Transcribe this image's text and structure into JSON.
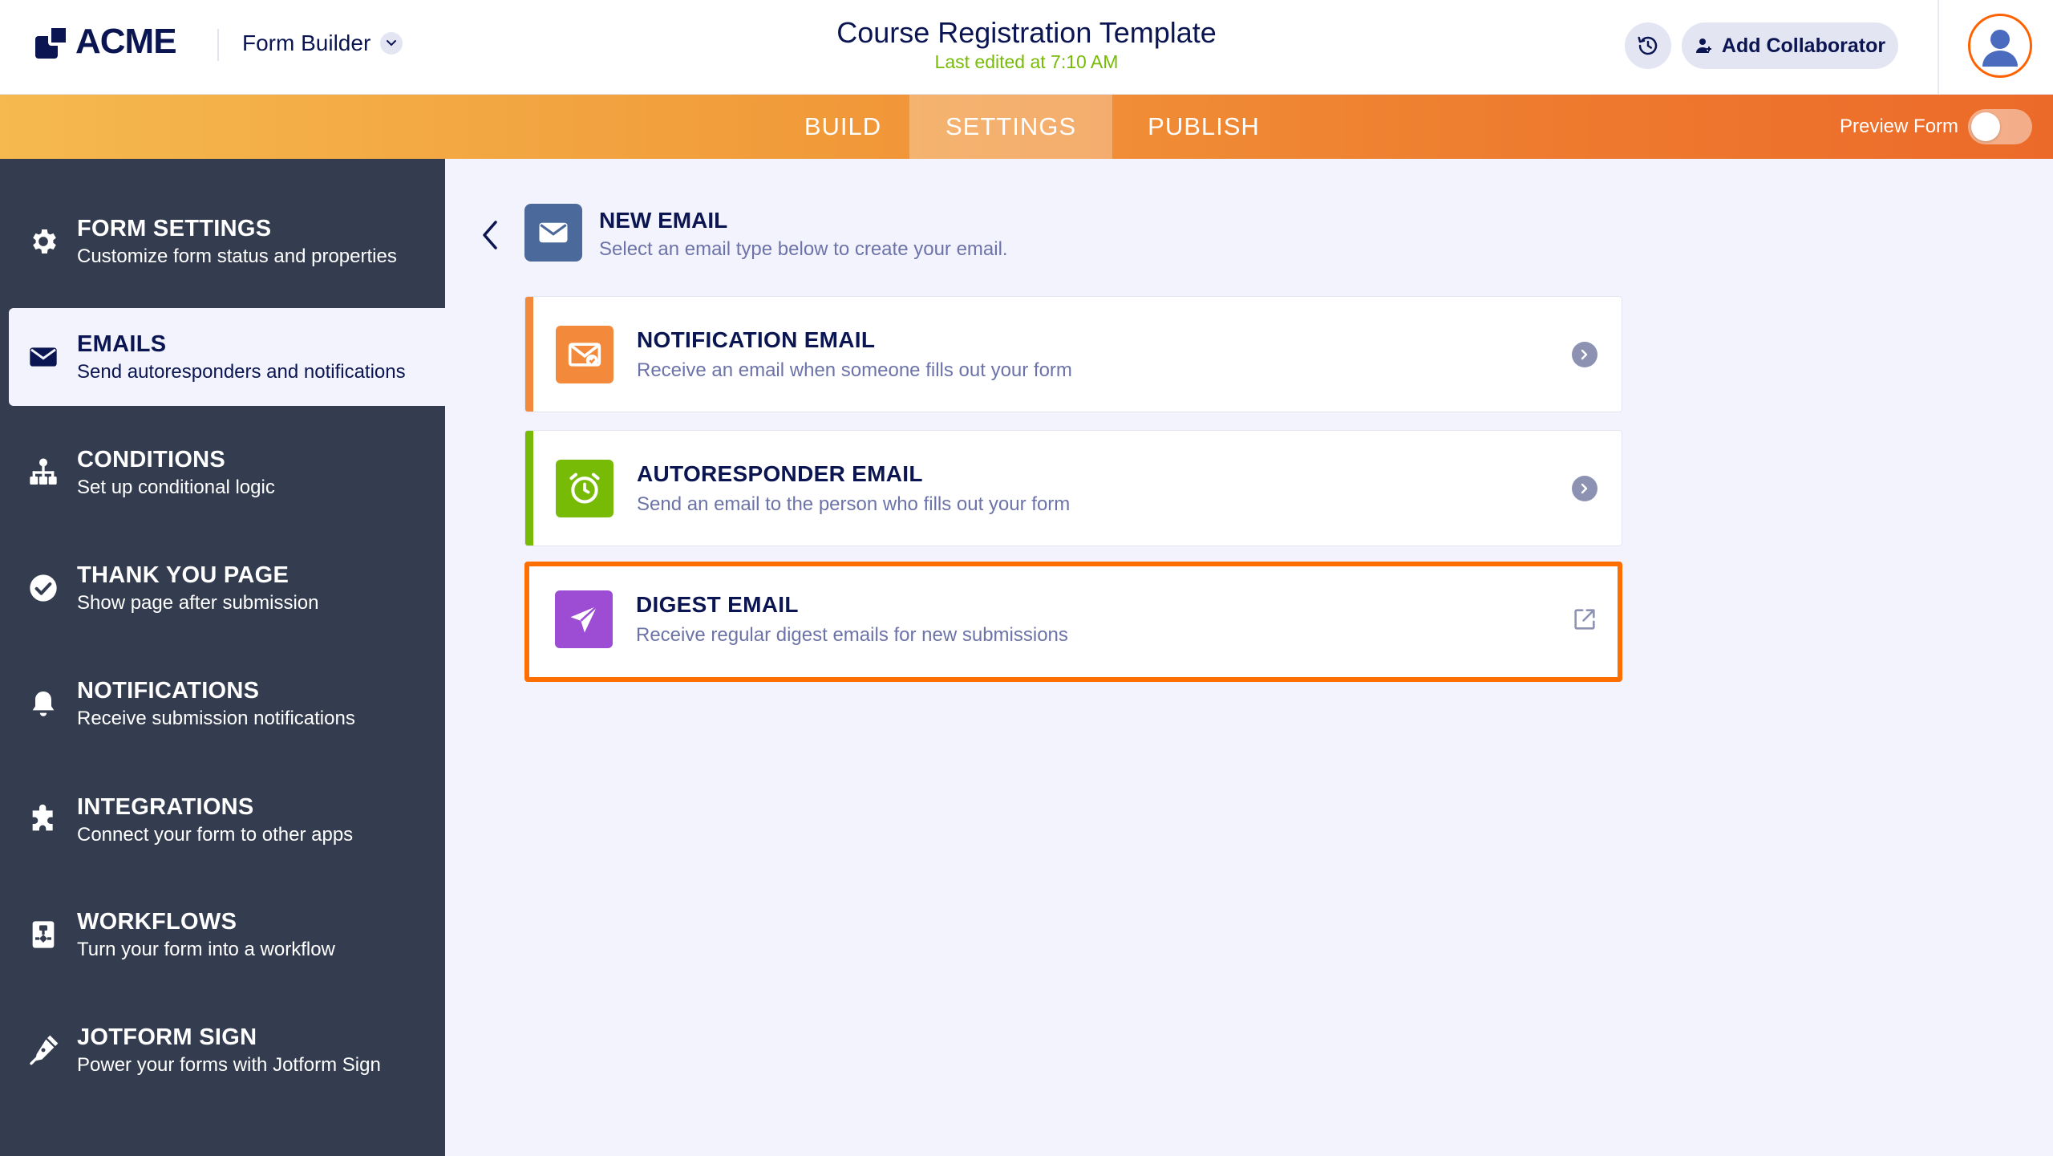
{
  "header": {
    "logo_text": "ACME",
    "app_switcher": "Form Builder",
    "title": "Course Registration Template",
    "subtitle": "Last edited at 7:10 AM",
    "add_collaborator": "Add Collaborator"
  },
  "nav": {
    "tabs": [
      {
        "label": "BUILD",
        "active": false
      },
      {
        "label": "SETTINGS",
        "active": true
      },
      {
        "label": "PUBLISH",
        "active": false
      }
    ],
    "preview_label": "Preview Form",
    "preview_on": false
  },
  "sidebar": {
    "items": [
      {
        "title": "FORM SETTINGS",
        "desc": "Customize form status and properties",
        "icon": "gear-icon",
        "active": false
      },
      {
        "title": "EMAILS",
        "desc": "Send autoresponders and notifications",
        "icon": "envelope-icon",
        "active": true
      },
      {
        "title": "CONDITIONS",
        "desc": "Set up conditional logic",
        "icon": "hierarchy-icon",
        "active": false
      },
      {
        "title": "THANK YOU PAGE",
        "desc": "Show page after submission",
        "icon": "check-circle-icon",
        "active": false
      },
      {
        "title": "NOTIFICATIONS",
        "desc": "Receive submission notifications",
        "icon": "bell-icon",
        "active": false
      },
      {
        "title": "INTEGRATIONS",
        "desc": "Connect your form to other apps",
        "icon": "puzzle-icon",
        "active": false
      },
      {
        "title": "WORKFLOWS",
        "desc": "Turn your form into a workflow",
        "icon": "workflow-icon",
        "active": false
      },
      {
        "title": "JOTFORM SIGN",
        "desc": "Power your forms with Jotform Sign",
        "icon": "pen-icon",
        "active": false
      }
    ]
  },
  "main": {
    "title": "NEW EMAIL",
    "subtitle": "Select an email type below to create your email.",
    "cards": [
      {
        "title": "NOTIFICATION EMAIL",
        "desc": "Receive an email when someone fills out your form",
        "color": "#f3893a",
        "icon": "mail-notification-icon"
      },
      {
        "title": "AUTORESPONDER EMAIL",
        "desc": "Send an email to the person who fills out your form",
        "color": "#78bb07",
        "icon": "alarm-clock-icon"
      },
      {
        "title": "DIGEST EMAIL",
        "desc": "Receive regular digest emails for new submissions",
        "color": "#9c4dd3",
        "icon": "paper-plane-icon",
        "highlight_color": "#ff6e00"
      }
    ]
  }
}
